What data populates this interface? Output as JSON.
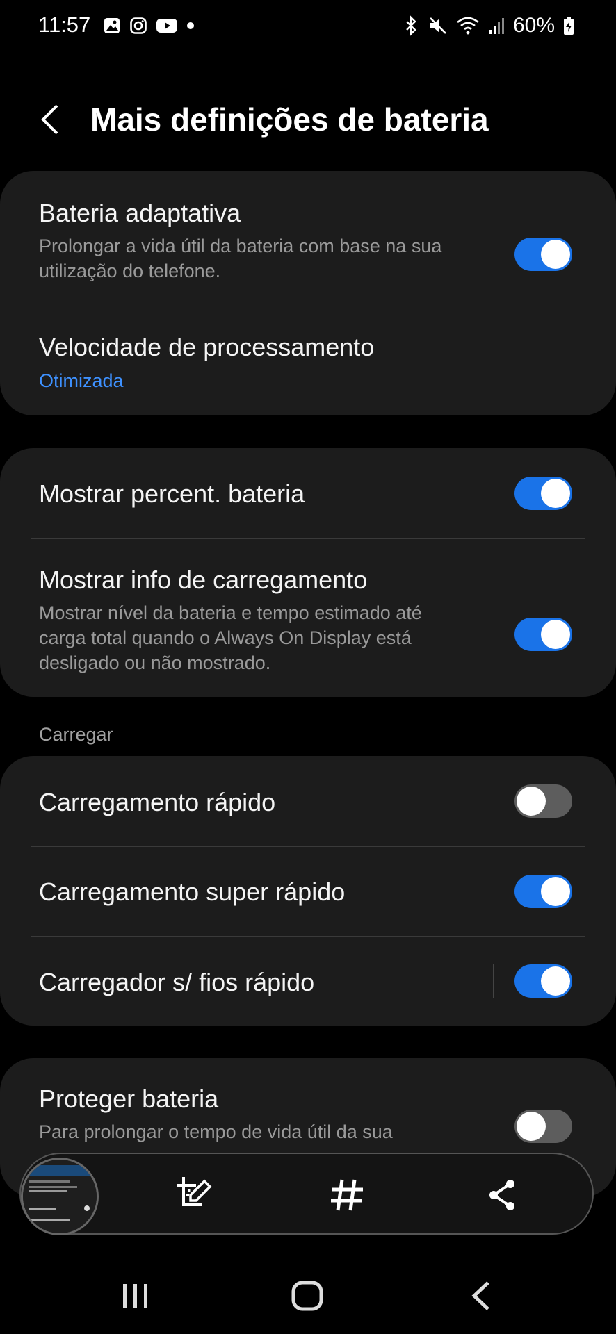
{
  "status_bar": {
    "time": "11:57",
    "battery": "60%",
    "left_icons": [
      "gallery-icon",
      "instagram-icon",
      "youtube-icon",
      "dot-icon"
    ],
    "right_icons": [
      "bluetooth-icon",
      "mute-icon",
      "wifi-icon",
      "signal-icon",
      "battery-charging-icon"
    ]
  },
  "header": {
    "title": "Mais definições de bateria",
    "back_icon": "chevron-left-icon"
  },
  "group1": {
    "adaptive": {
      "title": "Bateria adaptativa",
      "subtitle": "Prolongar a vida útil da bateria com base na sua utilização do telefone.",
      "on": true
    },
    "processing": {
      "title": "Velocidade de processamento",
      "value": "Otimizada"
    }
  },
  "group2": {
    "percent": {
      "title": "Mostrar percent. bateria",
      "on": true
    },
    "charge_info": {
      "title": "Mostrar info de carregamento",
      "subtitle": "Mostrar nível da bateria e tempo estimado até carga total quando o Always On Display está desligado ou não mostrado.",
      "on": true
    }
  },
  "charge_section": {
    "label": "Carregar",
    "fast": {
      "title": "Carregamento rápido",
      "on": false
    },
    "super_fast": {
      "title": "Carregamento super rápido",
      "on": true
    },
    "wireless": {
      "title": "Carregador s/ fios rápido",
      "on": true
    }
  },
  "group4": {
    "protect": {
      "title": "Proteger bateria",
      "subtitle": "Para prolongar o tempo de vida útil da sua",
      "on": false
    }
  },
  "screenshot_toolbar": {
    "icons": [
      "screenshot-thumbnail",
      "crop-edit-icon",
      "hashtag-icon",
      "share-icon"
    ]
  },
  "nav_bar": {
    "icons": [
      "recents-icon",
      "home-icon",
      "back-icon"
    ]
  },
  "colors": {
    "accent": "#1a73e8",
    "link": "#3e91ff",
    "card": "#1c1c1c",
    "background": "#000000"
  }
}
